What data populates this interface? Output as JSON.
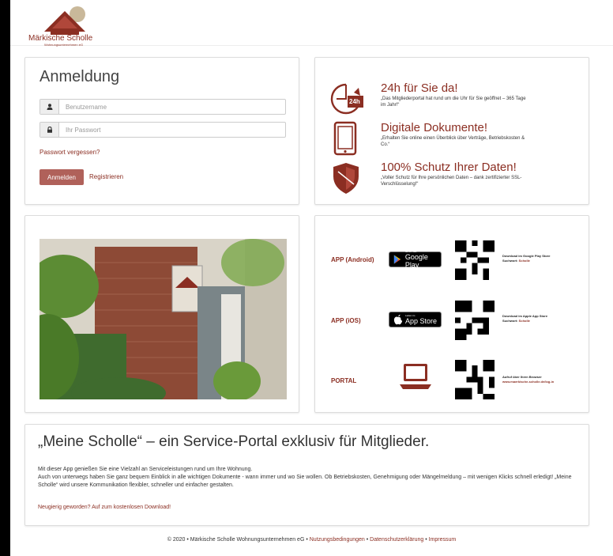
{
  "brand": {
    "name": "Märkische Scholle",
    "subtitle": "Wohnungsunternehmen eG"
  },
  "login": {
    "title": "Anmeldung",
    "username_placeholder": "Benutzername",
    "password_placeholder": "Ihr Passwort",
    "forgot": "Passwort vergessen?",
    "login_button": "Anmelden",
    "register": "Registrieren"
  },
  "features": [
    {
      "title": "24h für Sie da!",
      "desc": "„Das Mitgliederportal hat rund um die Uhr für Sie geöffnet – 365 Tage im Jahr!“",
      "icon": "clock-24h-icon",
      "badge": "24h"
    },
    {
      "title": "Digitale Dokumente!",
      "desc": "„Erhalten Sie online einen Überblick über Verträge, Betriebskosten & Co.“",
      "icon": "tablet-icon"
    },
    {
      "title": "100% Schutz Ihrer Daten!",
      "desc": "„Voller Schutz für Ihre persönlichen Daten – dank zertifizierter SSL-Verschlüsselung!“",
      "icon": "shield-icon"
    }
  ],
  "apps": [
    {
      "label": "APP (Android)",
      "badge_small": "JETZT BEI",
      "badge_big": "Google Play",
      "line1": "Download im Google Play Store",
      "line2_prefix": "Suchwort: ",
      "line2_value": "Scholle"
    },
    {
      "label": "APP (iOS)",
      "badge_small": "Laden im",
      "badge_big": "App Store",
      "line1": "Download im Apple App Store",
      "line2_prefix": "Suchwort: ",
      "line2_value": "Scholle"
    },
    {
      "label": "PORTAL",
      "line1": "Aufruf über Ihren Browser",
      "line2_value": "www.maerkische-scholle.de/log-in"
    }
  ],
  "info": {
    "title": "„Meine Scholle“ – ein Service-Portal exklusiv für Mitglieder.",
    "p1": "Mit dieser App genießen Sie eine Vielzahl an Serviceleistungen rund um Ihre Wohnung.",
    "p2": "Auch von unterwegs haben Sie ganz bequem Einblick in alle wichtigen Dokumente - wann immer und wo Sie wollen. Ob Betriebskosten, Genehmigung oder Mängelmeldung – mit wenigen Klicks schnell erledigt! „Meine Scholle“ wird unsere Kommunikation flexibler, schneller und einfacher gestalten.",
    "cta": "Neugierig geworden? Auf zum kostenlosen Download!"
  },
  "footer": {
    "copyright": "© 2020 • Märkische Scholle Wohnungsunternehmen eG • ",
    "terms": "Nutzungsbedingungen",
    "sep": " • ",
    "privacy": "Datenschutzerklärung",
    "imprint": "Impressum"
  },
  "colors": {
    "accent": "#8b2e22",
    "button": "#b0615a"
  }
}
